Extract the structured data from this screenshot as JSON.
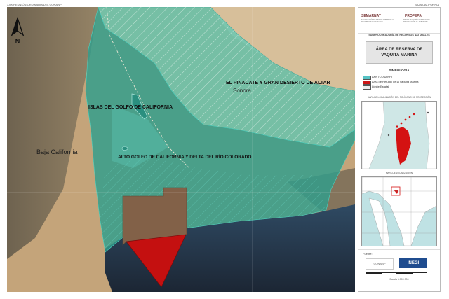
{
  "header": {
    "left": "XXX REUNIÓN ORDINARIA DEL CONANP",
    "right": "BAJA CALIFORNIA"
  },
  "map_labels": {
    "pinacate": "EL PINACATE Y GRAN DESIERTO DE ALTAR",
    "sonora": "Sonora",
    "islas": "ISLAS DEL GOLFO DE CALIFORNIA",
    "baja_california": "Baja California",
    "alto_golfo": "ALTO GOLFO DE CALIFORNIA Y DELTA DEL RÍO COLORADO",
    "north": "N"
  },
  "sidebar": {
    "logo_semarnat": "SEMARNAT",
    "logo_semarnat_sub": "SECRETARÍA DE MEDIO AMBIENTE Y RECURSOS NATURALES",
    "logo_profepa": "PROFEPA",
    "logo_profepa_sub": "PROCURADURÍA FEDERAL DE PROTECCIÓN AL AMBIENTE",
    "agency": "SUBPROCURADURÍA DE RECURSOS NATURALES",
    "title_line1": "ÁREA DE RESERVA DE",
    "title_line2": "VAQUITA MARINA",
    "simbologia": "SIMBOLOGÍA",
    "legend": [
      {
        "label": "ANP (CONANP)",
        "color": "#56c2c4"
      },
      {
        "label": "Área de Refugio de la Vaquita Marina",
        "color": "#cc1515"
      },
      {
        "label": "Límite Estatal",
        "color": "#eeeeee"
      }
    ],
    "inset1_label": "MAPA DE LOCALIZACIÓN DEL POLÍGONO DE PROTECCIÓN",
    "inset2_label": "MAPA DE LOCALIZACIÓN",
    "fuente": "Fuente:",
    "logo_conanp": "CONANP",
    "logo_inegi": "INEGI",
    "scale_label": "Escala 1:500 000"
  },
  "colors": {
    "desert": "#c8ac84",
    "sea": "#2c3f57",
    "anp_fill": "#3fb9ac",
    "refuge": "#c41010",
    "brown_zone": "#806248"
  }
}
